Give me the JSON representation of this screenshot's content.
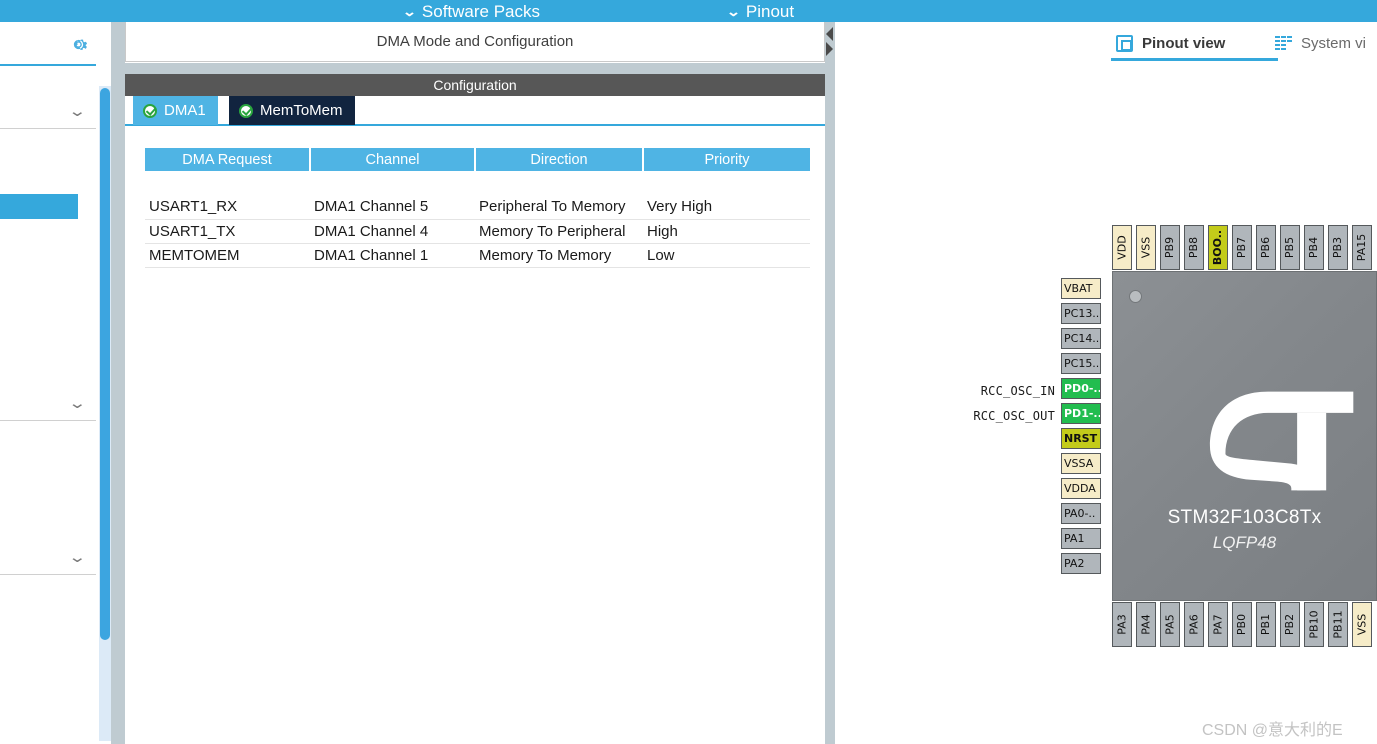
{
  "topbar": {
    "items": [
      {
        "id": "software-packs",
        "label": "Software Packs",
        "chevron": "chevron-down-icon",
        "glyph": "⌄"
      },
      {
        "id": "pinout",
        "label": "Pinout",
        "chevron": "chevron-down-icon",
        "glyph": "⌄"
      }
    ],
    "background": "#35a8dc"
  },
  "sidebar": {
    "gear_icon": "gear-icon",
    "groups": [
      {
        "id": "group-1",
        "chevron": "chevron-down-icon",
        "glyph": "⌄"
      },
      {
        "id": "group-2",
        "chevron": "chevron-down-icon",
        "glyph": "⌄"
      },
      {
        "id": "group-3",
        "chevron": "chevron-down-icon",
        "glyph": "⌄"
      }
    ],
    "selected_item": {
      "id": "selected-peripheral",
      "color": "#35a8dc"
    },
    "scrollbar": {
      "thumb_color": "#3ca5e0",
      "track_color": "#dceaf7"
    }
  },
  "center": {
    "panel_title": "DMA Mode and Configuration",
    "configuration_header": "Configuration",
    "tabs": [
      {
        "id": "tab-dma1",
        "label": "DMA1",
        "state": "enabled",
        "status_icon": "check-circle-icon",
        "style": "light"
      },
      {
        "id": "tab-memtomem",
        "label": "MemToMem",
        "state": "selected",
        "status_icon": "check-circle-icon",
        "style": "dark"
      }
    ],
    "table": {
      "headers": [
        "DMA Request",
        "Channel",
        "Direction",
        "Priority"
      ],
      "rows": [
        [
          "USART1_RX",
          "DMA1 Channel 5",
          "Peripheral To Memory",
          "Very High"
        ],
        [
          "USART1_TX",
          "DMA1 Channel 4",
          "Memory To Peripheral",
          "High"
        ],
        [
          "MEMTOMEM",
          "DMA1 Channel 1",
          "Memory To Memory",
          "Low"
        ]
      ],
      "header_color": "#4fb4e4"
    }
  },
  "splitter": {
    "collapse_left_icon": "triangle-left-icon",
    "collapse_right_icon": "triangle-right-icon"
  },
  "right": {
    "view_tabs": [
      {
        "id": "tab-pinout-view",
        "label": "Pinout view",
        "icon": "chip-icon",
        "selected": true
      },
      {
        "id": "tab-system-view",
        "label": "System vi",
        "icon": "bars-icon",
        "selected": false
      }
    ],
    "chip": {
      "name": "STM32F103C8Tx",
      "package": "LQFP48",
      "logo": "st-logo",
      "orientation_dot": "orientation-dot"
    },
    "pins": {
      "top": [
        {
          "label": "VDD",
          "color": "cream"
        },
        {
          "label": "VSS",
          "color": "cream"
        },
        {
          "label": "PB9",
          "color": "gray"
        },
        {
          "label": "PB8",
          "color": "gray"
        },
        {
          "label": "BOO..",
          "color": "olive"
        },
        {
          "label": "PB7",
          "color": "gray"
        },
        {
          "label": "PB6",
          "color": "gray"
        },
        {
          "label": "PB5",
          "color": "gray"
        },
        {
          "label": "PB4",
          "color": "gray"
        },
        {
          "label": "PB3",
          "color": "gray"
        },
        {
          "label": "PA15",
          "color": "gray"
        }
      ],
      "left": [
        {
          "label": "VBAT",
          "color": "cream",
          "signal": ""
        },
        {
          "label": "PC13..",
          "color": "gray",
          "signal": ""
        },
        {
          "label": "PC14..",
          "color": "gray",
          "signal": ""
        },
        {
          "label": "PC15..",
          "color": "gray",
          "signal": ""
        },
        {
          "label": "PD0-..",
          "color": "green",
          "signal": "RCC_OSC_IN"
        },
        {
          "label": "PD1-..",
          "color": "green",
          "signal": "RCC_OSC_OUT"
        },
        {
          "label": "NRST",
          "color": "olive",
          "signal": ""
        },
        {
          "label": "VSSA",
          "color": "cream",
          "signal": ""
        },
        {
          "label": "VDDA",
          "color": "cream",
          "signal": ""
        },
        {
          "label": "PA0-..",
          "color": "gray",
          "signal": ""
        },
        {
          "label": "PA1",
          "color": "gray",
          "signal": ""
        },
        {
          "label": "PA2",
          "color": "gray",
          "signal": ""
        }
      ],
      "bottom": [
        {
          "label": "PA3",
          "color": "gray"
        },
        {
          "label": "PA4",
          "color": "gray"
        },
        {
          "label": "PA5",
          "color": "gray"
        },
        {
          "label": "PA6",
          "color": "gray"
        },
        {
          "label": "PA7",
          "color": "gray"
        },
        {
          "label": "PB0",
          "color": "gray"
        },
        {
          "label": "PB1",
          "color": "gray"
        },
        {
          "label": "PB2",
          "color": "gray"
        },
        {
          "label": "PB10",
          "color": "gray"
        },
        {
          "label": "PB11",
          "color": "gray"
        },
        {
          "label": "VSS",
          "color": "cream"
        }
      ]
    }
  },
  "watermark": "CSDN @意大利的E",
  "colors": {
    "accent_blue": "#35a8dc",
    "tab_light_blue": "#4fb4e4",
    "tab_dark_navy": "#11243f",
    "config_bar_gray": "#575757",
    "pin_green": "#22bd4f",
    "pin_olive": "#c3cb1a",
    "pin_cream": "#f6ecc8",
    "pin_gray": "#b0b6bb"
  }
}
